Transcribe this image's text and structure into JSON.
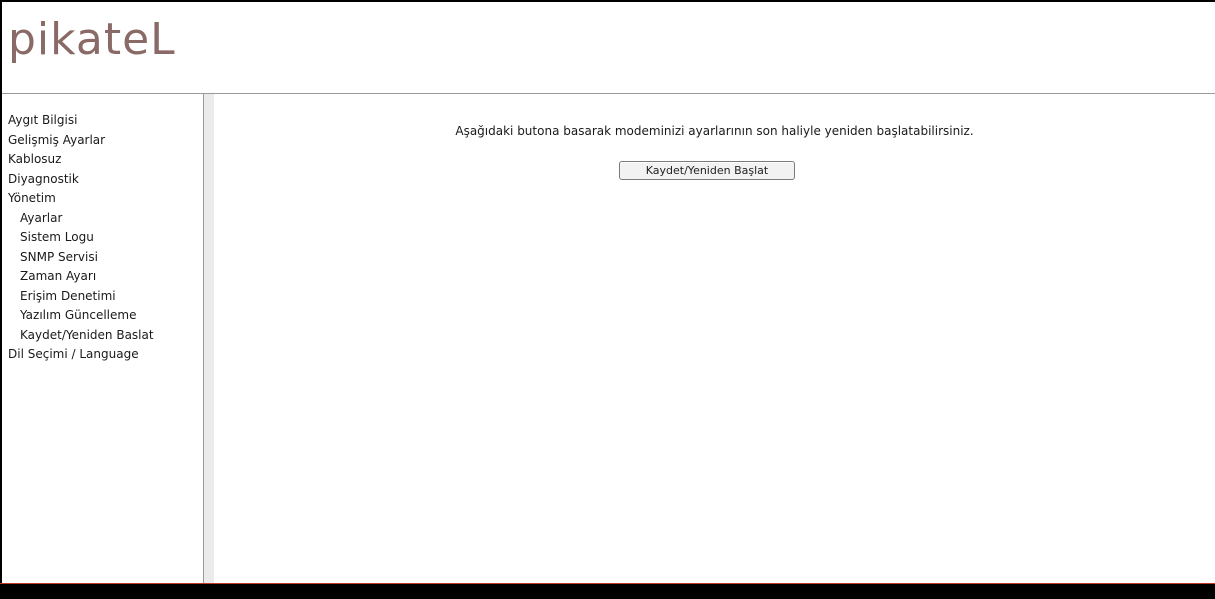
{
  "logo": {
    "text": "pikateL"
  },
  "sidebar": {
    "items": [
      {
        "label": "Aygıt Bilgisi"
      },
      {
        "label": "Gelişmiş Ayarlar"
      },
      {
        "label": "Kablosuz"
      },
      {
        "label": "Diyagnostik"
      },
      {
        "label": "Yönetim"
      },
      {
        "label": "Ayarlar"
      },
      {
        "label": "Sistem Logu"
      },
      {
        "label": "SNMP Servisi"
      },
      {
        "label": "Zaman Ayarı"
      },
      {
        "label": "Erişim Denetimi"
      },
      {
        "label": "Yazılım Güncelleme"
      },
      {
        "label": "Kaydet/Yeniden Baslat"
      },
      {
        "label": "Dil Seçimi / Language"
      }
    ]
  },
  "main": {
    "message": "Aşağıdaki butona basarak modeminizi ayarlarının son haliyle yeniden başlatabilirsiniz.",
    "button_label": "Kaydet/Yeniden Başlat"
  },
  "colors": {
    "logo": "#8a6a66",
    "footer": "#000000",
    "footer_accent": "#c0392b"
  }
}
